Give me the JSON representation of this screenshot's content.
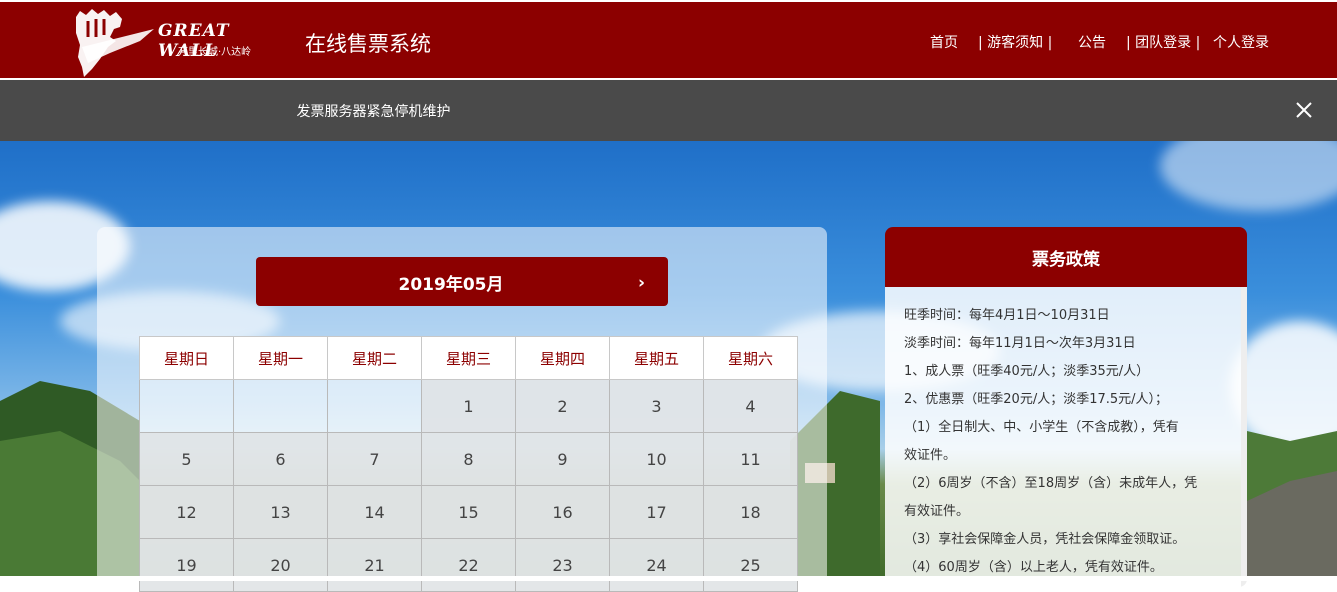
{
  "header": {
    "logo_en": "GREAT WALL",
    "logo_cn": "万里长城·八达岭",
    "site_title": "在线售票系统",
    "nav": [
      {
        "label": "首页"
      },
      {
        "label": "| 游客须知 |"
      },
      {
        "label": "公告"
      },
      {
        "label": "| 团队登录 |"
      },
      {
        "label": "个人登录"
      }
    ]
  },
  "notice": {
    "text": "发票服务器紧急停机维护",
    "close_icon": "close-icon"
  },
  "calendar": {
    "month_label": "2019年05月",
    "next_label": "›",
    "weekdays": [
      "星期日",
      "星期一",
      "星期二",
      "星期三",
      "星期四",
      "星期五",
      "星期六"
    ],
    "weeks": [
      [
        "",
        "",
        "",
        "1",
        "2",
        "3",
        "4"
      ],
      [
        "5",
        "6",
        "7",
        "8",
        "9",
        "10",
        "11"
      ],
      [
        "12",
        "13",
        "14",
        "15",
        "16",
        "17",
        "18"
      ],
      [
        "19",
        "20",
        "21",
        "22",
        "23",
        "24",
        "25"
      ]
    ]
  },
  "policy": {
    "title": "票务政策",
    "lines": [
      "旺季时间：每年4月1日～10月31日",
      "淡季时间：每年11月1日～次年3月31日",
      "1、成人票（旺季40元/人；淡季35元/人）",
      "2、优惠票（旺季20元/人；淡季17.5元/人）；",
      "（1）全日制大、中、小学生（不含成教），凭有",
      "效证件。",
      "（2）6周岁（不含）至18周岁（含）未成年人，凭",
      "有效证件。",
      "（3）享社会保障金人员，凭社会保障金领取证。",
      "（4）60周岁（含）以上老人，凭有效证件。"
    ]
  },
  "colors": {
    "brand_red": "#8c0000",
    "notice_bg": "#4a4a4a"
  }
}
